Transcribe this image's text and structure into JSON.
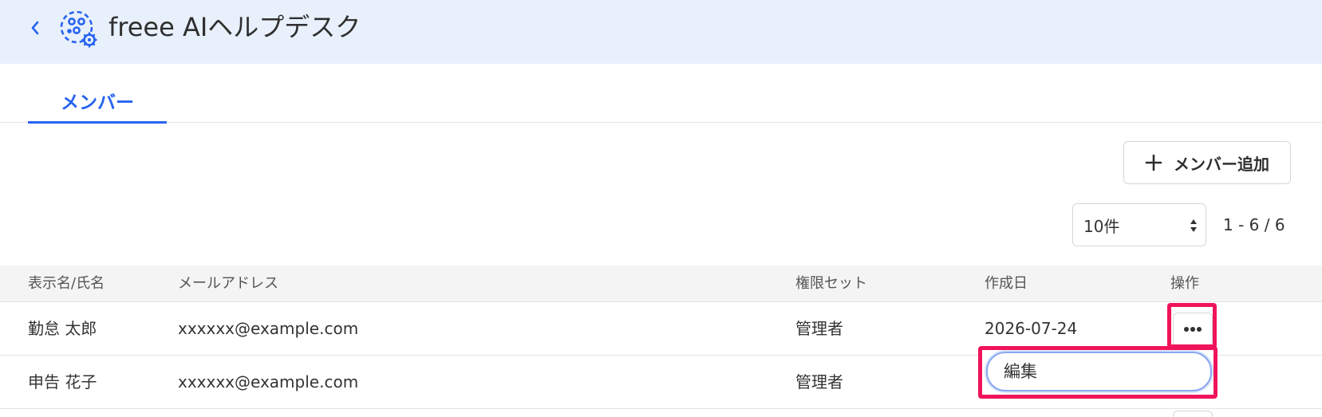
{
  "header": {
    "title": "freee AIヘルプデスク",
    "back_icon": "chevron-left-icon",
    "logo_icon": "helpdesk-gear-icon"
  },
  "tabs": [
    {
      "label": "メンバー",
      "active": true
    }
  ],
  "toolbar": {
    "add_member_label": "メンバー追加",
    "add_icon": "plus-icon"
  },
  "pagination": {
    "page_size": "10件",
    "range_text": "1 - 6 / 6"
  },
  "table": {
    "columns": [
      "表示名/氏名",
      "メールアドレス",
      "権限セット",
      "作成日",
      "操作"
    ],
    "rows": [
      {
        "name": "勤怠 太郎",
        "email": "xxxxxx@example.com",
        "role": "管理者",
        "created": "2026-07-24"
      },
      {
        "name": "申告 花子",
        "email": "xxxxxx@example.com",
        "role": "管理者",
        "created": ""
      }
    ]
  },
  "menu": {
    "items": [
      "編集"
    ]
  },
  "colors": {
    "accent": "#2864f0",
    "header_bg": "#e8f0fc",
    "highlight": "#f0145a"
  }
}
